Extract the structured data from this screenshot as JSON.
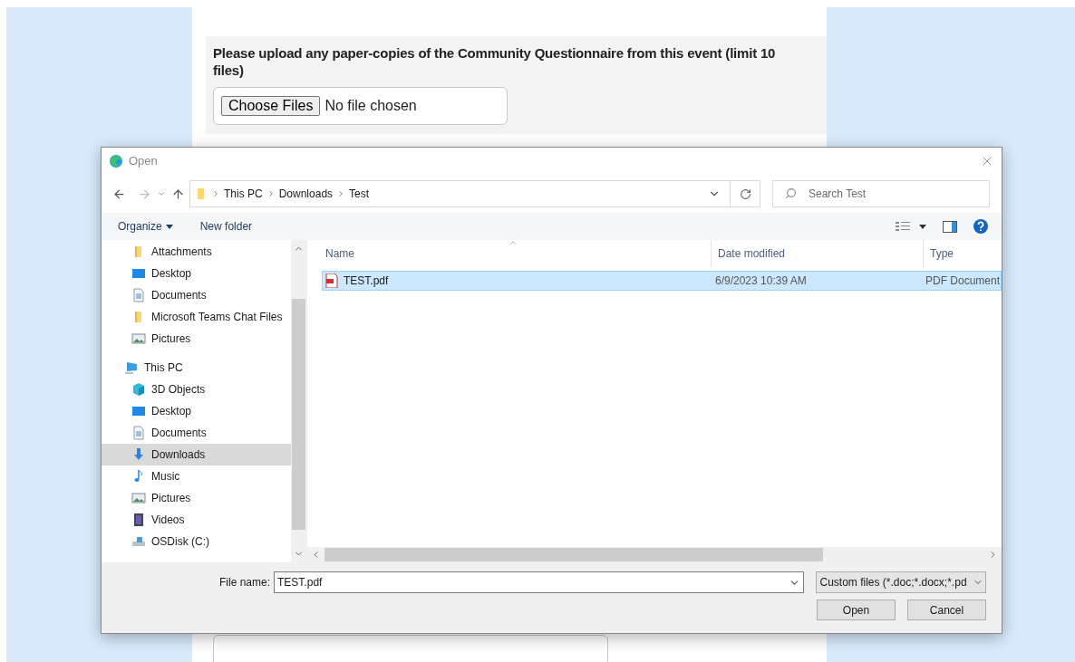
{
  "form": {
    "question": "Please upload any paper-copies of the Community Questionnaire from this event (limit 10 files)",
    "choose_button": "Choose Files",
    "file_status": "No file chosen"
  },
  "dialog": {
    "title": "Open",
    "path": [
      "This PC",
      "Downloads",
      "Test"
    ],
    "search": {
      "placeholder": "Search Test"
    },
    "toolbar": {
      "organize": "Organize",
      "new_folder": "New folder"
    },
    "quick_access": [
      {
        "label": "Attachments",
        "kind": "folder",
        "selected": false
      },
      {
        "label": "Desktop",
        "kind": "desktop",
        "selected": false
      },
      {
        "label": "Documents",
        "kind": "document",
        "selected": false
      },
      {
        "label": "Microsoft Teams Chat Files",
        "kind": "folder",
        "selected": false
      },
      {
        "label": "Pictures",
        "kind": "picture",
        "selected": false
      }
    ],
    "this_pc": {
      "label": "This PC",
      "kind": "pc",
      "selected": false,
      "children": [
        {
          "label": "3D Objects",
          "kind": "cube",
          "selected": false
        },
        {
          "label": "Desktop",
          "kind": "desktop",
          "selected": false
        },
        {
          "label": "Documents",
          "kind": "document",
          "selected": false
        },
        {
          "label": "Downloads",
          "kind": "download",
          "selected": true
        },
        {
          "label": "Music",
          "kind": "music",
          "selected": false
        },
        {
          "label": "Pictures",
          "kind": "picture",
          "selected": false
        },
        {
          "label": "Videos",
          "kind": "video",
          "selected": false
        },
        {
          "label": "OSDisk (C:)",
          "kind": "drive",
          "selected": false
        }
      ]
    },
    "columns": [
      "Name",
      "Date modified",
      "Type"
    ],
    "files": [
      {
        "name": "TEST.pdf",
        "date": "6/9/2023 10:39 AM",
        "type": "PDF Document",
        "selected": true
      }
    ],
    "file_name_label": "File name:",
    "file_name": "TEST.pdf",
    "file_type": "Custom files (*.doc;*.docx;*.pd",
    "open_button": "Open",
    "cancel_button": "Cancel"
  }
}
